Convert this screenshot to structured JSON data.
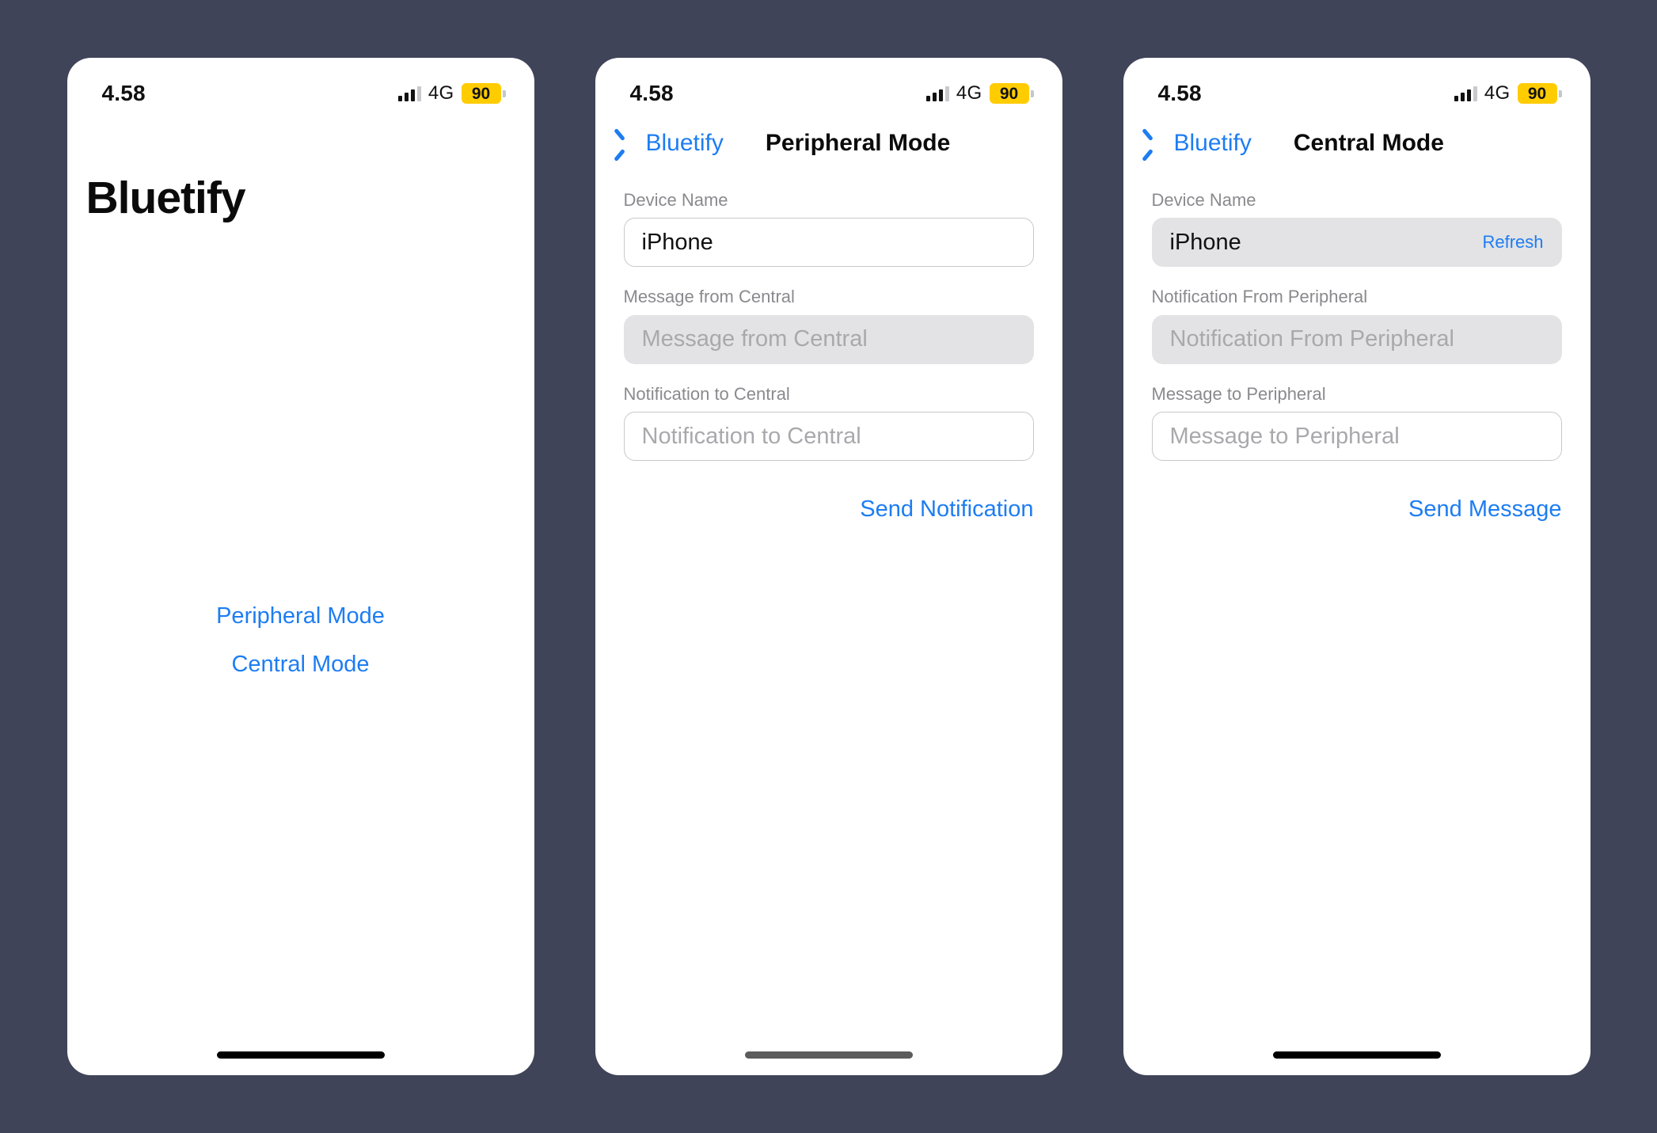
{
  "background_color": "#404458",
  "accent_color": "#1d7df2",
  "battery_color": "#ffcc00",
  "status_bar": {
    "time": "4.58",
    "network": "4G",
    "battery_level": "90",
    "signal_icon": "cellular-signal-icon",
    "battery_icon": "battery-low-power-icon"
  },
  "screens": [
    {
      "id": "home",
      "app_title": "Bluetify",
      "links": [
        {
          "label": "Peripheral Mode"
        },
        {
          "label": "Central Mode"
        }
      ],
      "home_indicator_style": "black"
    },
    {
      "id": "peripheral",
      "nav": {
        "back_label": "Bluetify",
        "back_icon": "chevron-left-icon",
        "title": "Peripheral Mode"
      },
      "fields": [
        {
          "label": "Device Name",
          "value": "iPhone",
          "placeholder": "",
          "style": "outlined",
          "is_placeholder": false,
          "action": null
        },
        {
          "label": "Message from Central",
          "value": "Message from Central",
          "placeholder": "Message from Central",
          "style": "filled",
          "is_placeholder": true,
          "action": null
        },
        {
          "label": "Notification to Central",
          "value": "Notification to Central",
          "placeholder": "Notification to Central",
          "style": "outlined",
          "is_placeholder": true,
          "action": null
        }
      ],
      "primary_action": "Send Notification",
      "home_indicator_style": "dim"
    },
    {
      "id": "central",
      "nav": {
        "back_label": "Bluetify",
        "back_icon": "chevron-left-icon",
        "title": "Central Mode"
      },
      "fields": [
        {
          "label": "Device Name",
          "value": "iPhone",
          "placeholder": "",
          "style": "filled",
          "is_placeholder": false,
          "action": "Refresh"
        },
        {
          "label": "Notification From Peripheral",
          "value": "Notification From Peripheral",
          "placeholder": "Notification From Peripheral",
          "style": "filled",
          "is_placeholder": true,
          "action": null
        },
        {
          "label": "Message to Peripheral",
          "value": "Message to Peripheral",
          "placeholder": "Message to Peripheral",
          "style": "outlined",
          "is_placeholder": true,
          "action": null
        }
      ],
      "primary_action": "Send Message",
      "home_indicator_style": "black"
    }
  ]
}
